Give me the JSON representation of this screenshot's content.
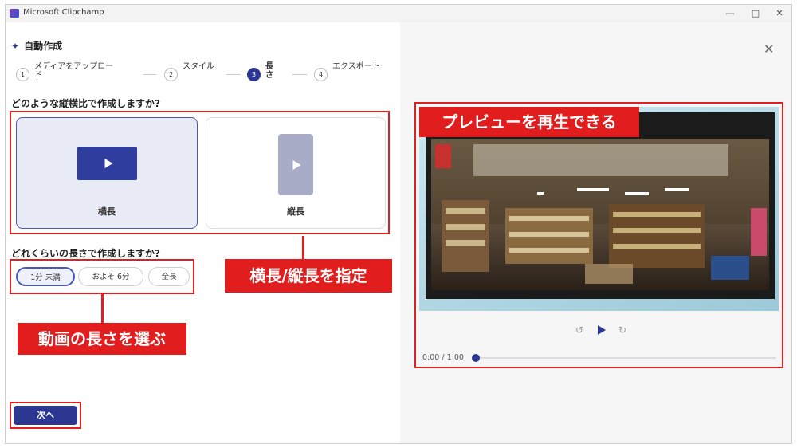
{
  "window": {
    "title": "Microsoft Clipchamp",
    "minimize": "—",
    "maximize": "□",
    "close": "✕"
  },
  "header": {
    "icon": "sparkle-icon",
    "title": "自動作成"
  },
  "steps": [
    {
      "num": "1",
      "label": "メディアをアップロード"
    },
    {
      "num": "2",
      "label": "スタイル"
    },
    {
      "num": "3",
      "label": "長さ"
    },
    {
      "num": "4",
      "label": "エクスポート"
    }
  ],
  "aspect": {
    "question": "どのような縦横比で作成しますか?",
    "landscape_label": "横長",
    "portrait_label": "縦長"
  },
  "length": {
    "question": "どれくらいの長さで作成しますか?",
    "options": [
      "1分 未満",
      "およそ 6分",
      "全長"
    ]
  },
  "callouts": {
    "preview": "プレビューを再生できる",
    "aspect": "横長/縦長を指定",
    "length": "動画の長さを選ぶ"
  },
  "next_button": "次へ",
  "player": {
    "time": "0:00 / 1:00",
    "rewind": "↺",
    "forward": "↻",
    "progress": 0
  },
  "colors": {
    "accent": "#2b3790",
    "callout": "#e21d1d"
  }
}
